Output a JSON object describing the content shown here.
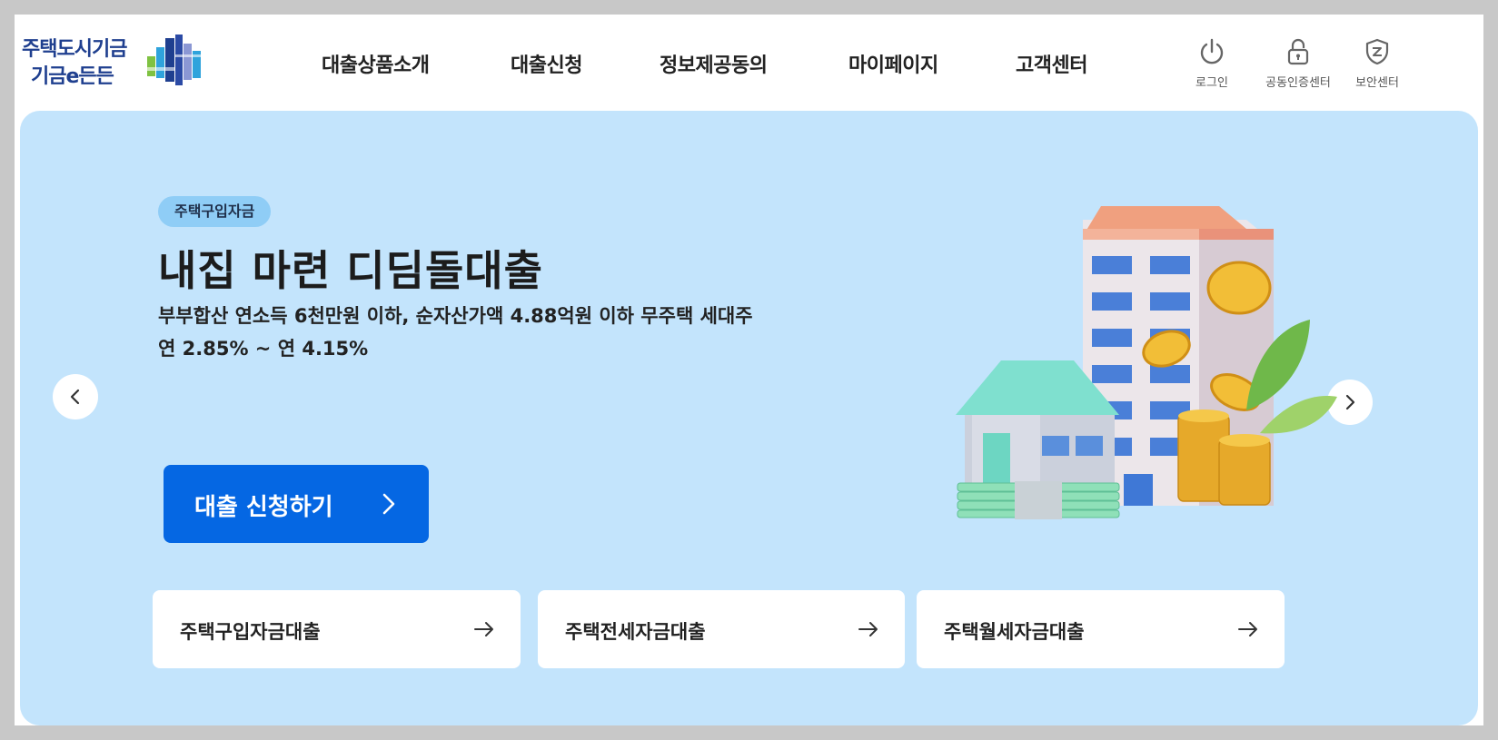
{
  "logo": {
    "line1": "주택도시기금",
    "line2": "기금e든든"
  },
  "nav": {
    "items": [
      {
        "label": "대출상품소개"
      },
      {
        "label": "대출신청"
      },
      {
        "label": "정보제공동의"
      },
      {
        "label": "마이페이지"
      },
      {
        "label": "고객센터"
      }
    ]
  },
  "util": {
    "login": {
      "label": "로그인",
      "icon": "power-icon"
    },
    "cert": {
      "label": "공동인증센터",
      "icon": "lock-icon"
    },
    "security": {
      "label": "보안센터",
      "icon": "shield-icon"
    }
  },
  "hero": {
    "badge": "주택구입자금",
    "title": "내집 마련 디딤돌대출",
    "description": "부부합산 연소득 6천만원 이하, 순자산가액 4.88억원 이하 무주택 세대주",
    "rate": "연 2.85% ~ 연 4.15%",
    "apply_label": "대출 신청하기"
  },
  "quick_links": [
    {
      "label": "주택구입자금대출"
    },
    {
      "label": "주택전세자금대출"
    },
    {
      "label": "주택월세자금대출"
    }
  ],
  "colors": {
    "hero_bg": "#c3e4fc",
    "primary": "#0567e3",
    "badge_bg": "#8fcdf6",
    "logo_text": "#1f3f8f"
  }
}
